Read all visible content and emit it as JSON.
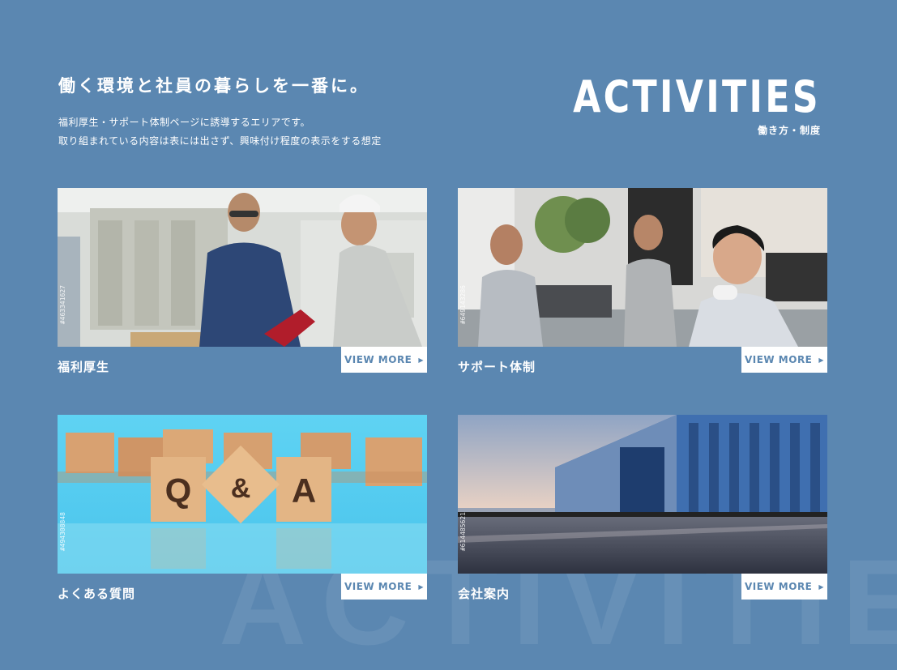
{
  "background_text": "ACTIVITIES",
  "header": {
    "headline": "働く環境と社員の暮らしを一番に。",
    "intro_lines": [
      "福利厚生・サポート体制ページに誘導するエリアです。",
      "取り組まれている内容は表には出さず、興味付け程度の表示をする想定"
    ],
    "section_title_en": "ACTIVITIES",
    "section_title_jp": "働き方・制度"
  },
  "cards": [
    {
      "label": "福利厚生",
      "more": "VIEW MORE",
      "photo": "factory-workers-photo",
      "stock_id": "#463341627"
    },
    {
      "label": "サポート体制",
      "more": "VIEW MORE",
      "photo": "call-center-photo",
      "stock_id": "#649143286"
    },
    {
      "label": "よくある質問",
      "more": "VIEW MORE",
      "photo": "qa-wooden-blocks-photo",
      "stock_id": "#494308848",
      "photo_text": "Q&A"
    },
    {
      "label": "会社案内",
      "more": "VIEW MORE",
      "photo": "warehouse-building-photo",
      "stock_id": "#614485621"
    }
  ],
  "colors": {
    "background": "#5b87b1",
    "button_text": "#5b87b1",
    "button_bg": "#ffffff"
  },
  "icons": {
    "more_arrow": "triangle-right-icon"
  }
}
